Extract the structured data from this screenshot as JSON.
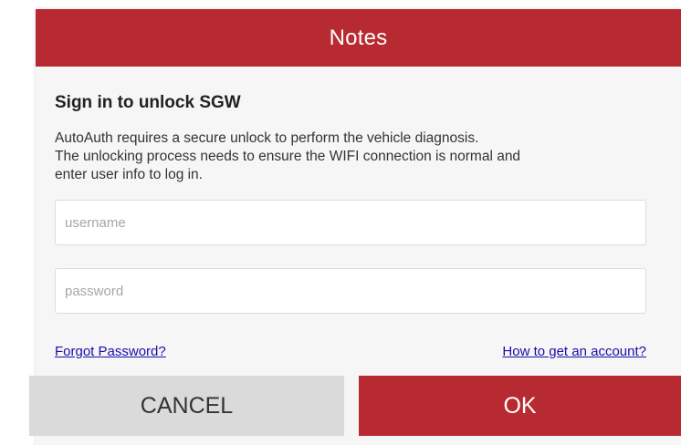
{
  "dialog": {
    "title": "Notes",
    "heading": "Sign in to unlock SGW",
    "description_lines": [
      "AutoAuth requires a secure unlock to perform the vehicle diagnosis.",
      "The unlocking process needs to ensure the WIFI connection is normal and",
      "enter user info to  log in."
    ],
    "username": {
      "value": "",
      "placeholder": "username"
    },
    "password": {
      "value": "",
      "placeholder": "password"
    },
    "forgot_link": "Forgot Password?",
    "account_link": "How to get an account?",
    "cancel_label": "CANCEL",
    "ok_label": "OK"
  },
  "colors": {
    "accent": "#b82a31",
    "cancel_bg": "#dadada",
    "link": "#1a0dab",
    "dialog_bg": "#f6f6f6"
  }
}
